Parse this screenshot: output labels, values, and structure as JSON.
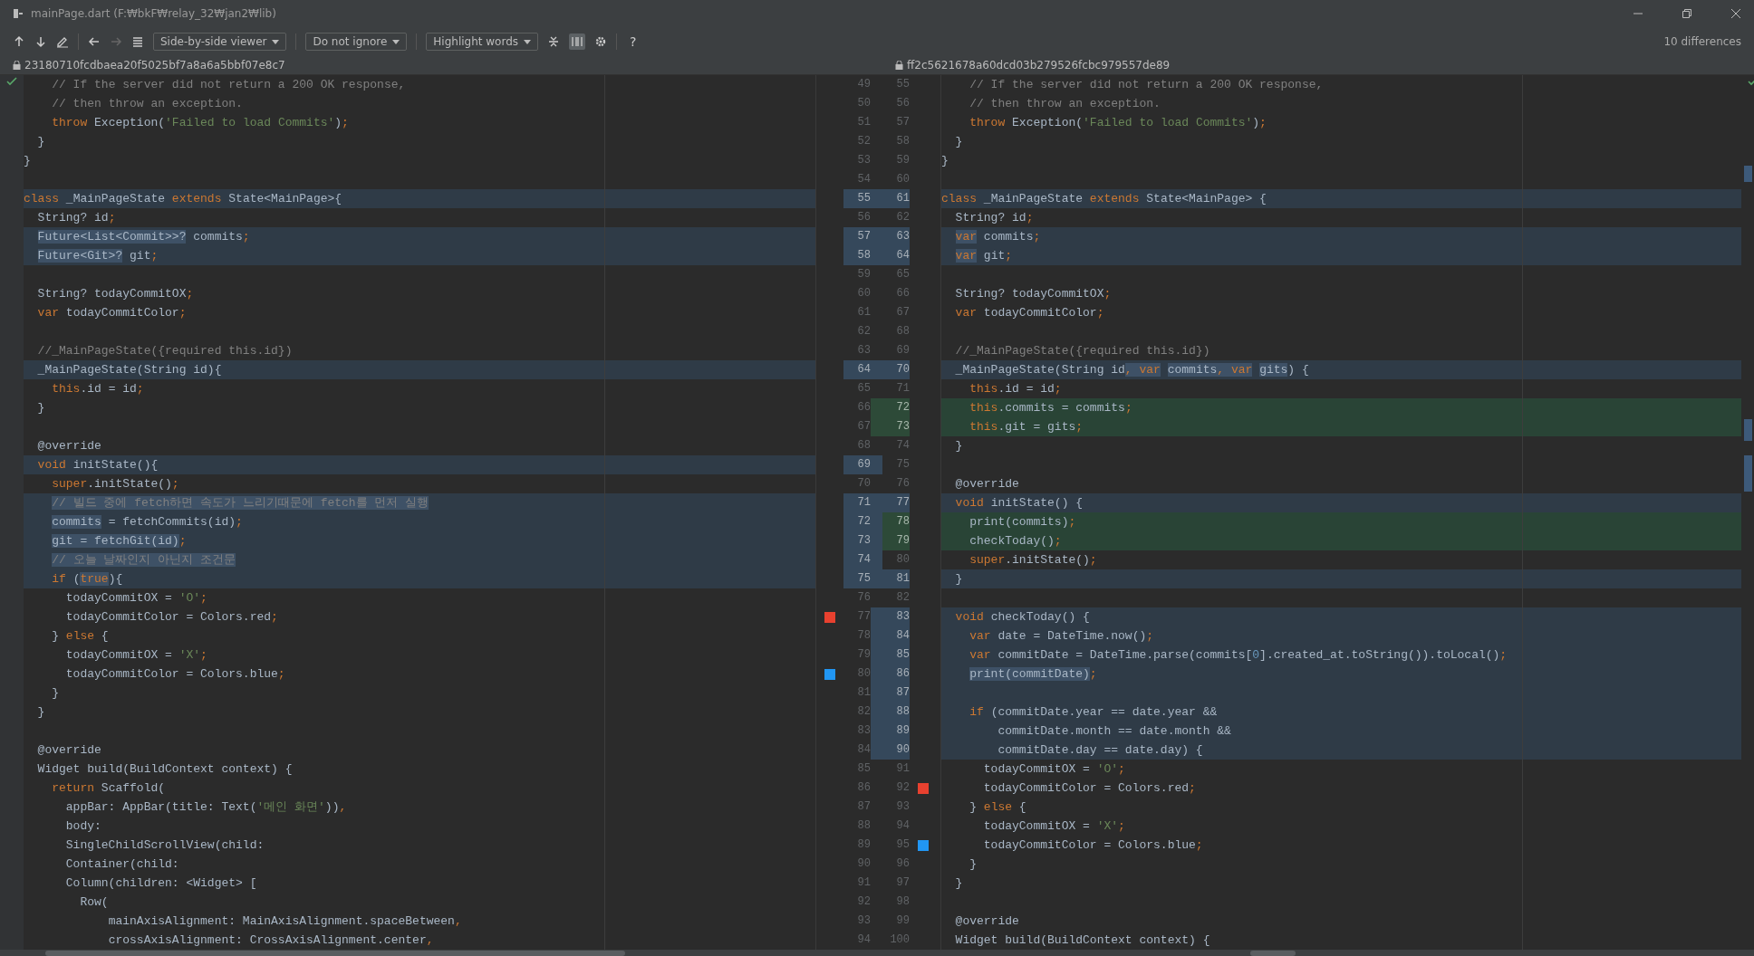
{
  "window": {
    "title": "mainPage.dart (F:₩bkF₩relay_32₩jan2₩lib)"
  },
  "toolbar": {
    "next_file": {
      "disabled": true
    },
    "viewer": "Side-by-side viewer",
    "ignore": "Do not ignore",
    "highlight": "Highlight words",
    "layout_toggle": {
      "selected": true
    },
    "help": "?",
    "differences": "10 differences"
  },
  "left": {
    "revision": "23180710fcdbaea20f5025bf7a8a6a5bbf07e8c7",
    "lines": [
      {
        "n": "49",
        "kind": "plain",
        "tokens": [
          {
            "t": "    // If the server did not return a 200 OK response,",
            "kind": "comment"
          }
        ]
      },
      {
        "n": "50",
        "kind": "plain",
        "tokens": [
          {
            "t": "    // then throw an exception.",
            "kind": "comment"
          }
        ]
      },
      {
        "n": "51",
        "kind": "plain",
        "tokens": [
          {
            "t": "    throw",
            "kind": "keyword"
          },
          {
            "t": " Exception("
          },
          {
            "t": "'Failed to load Commits'",
            "kind": "string"
          },
          {
            "t": ");"
          }
        ]
      },
      {
        "n": "52",
        "kind": "plain",
        "tokens": [
          {
            "t": "  }"
          }
        ]
      },
      {
        "n": "53",
        "kind": "plain",
        "tokens": [
          {
            "t": "}"
          }
        ]
      },
      {
        "n": "54",
        "kind": "plain"
      },
      {
        "n": "55",
        "kind": "changed",
        "tokens": [
          {
            "t": "class",
            "kind": "keyword"
          },
          {
            "t": " _MainPageState "
          },
          {
            "t": "extends",
            "kind": "keyword"
          },
          {
            "t": " State<MainPage>{"
          }
        ]
      },
      {
        "n": "56",
        "kind": "plain",
        "tokens": [
          {
            "t": "  String? id;"
          }
        ]
      },
      {
        "n": "57",
        "kind": "changed",
        "tokens": [
          {
            "t": "  Future<List<Commit>>?",
            "hl": true
          },
          {
            "t": " commits;"
          }
        ]
      },
      {
        "n": "58",
        "kind": "changed",
        "tokens": [
          {
            "t": "  Future<Git>?",
            "hl": true
          },
          {
            "t": " git;"
          }
        ]
      },
      {
        "n": "59",
        "kind": "plain"
      },
      {
        "n": "60",
        "kind": "plain",
        "tokens": [
          {
            "t": "  String? todayCommitOX;"
          }
        ]
      },
      {
        "n": "61",
        "kind": "plain",
        "tokens": [
          {
            "t": "  var",
            "kind": "keyword"
          },
          {
            "t": " todayCommitColor;"
          }
        ]
      },
      {
        "n": "62",
        "kind": "plain"
      },
      {
        "n": "63",
        "kind": "plain",
        "tokens": [
          {
            "t": "  //_MainPageState({required this.id})",
            "kind": "comment"
          }
        ]
      },
      {
        "n": "64",
        "kind": "changed",
        "tokens": [
          {
            "t": "  _MainPageState(String id){"
          }
        ]
      },
      {
        "n": "65",
        "kind": "plain",
        "tokens": [
          {
            "t": "    this",
            "kind": "keyword"
          },
          {
            "t": ".id = id;"
          }
        ]
      },
      {
        "n": "66",
        "kind": "plain",
        "tokens": [
          {
            "t": "  }"
          }
        ]
      },
      {
        "n": "67",
        "kind": "plain"
      },
      {
        "n": "68",
        "kind": "plain",
        "tokens": [
          {
            "t": "  @override"
          }
        ]
      },
      {
        "n": "69",
        "kind": "changed",
        "tokens": [
          {
            "t": "  void",
            "kind": "keyword"
          },
          {
            "t": " initState(){"
          }
        ]
      },
      {
        "n": "70",
        "kind": "plain",
        "tokens": [
          {
            "t": "    super",
            "kind": "keyword"
          },
          {
            "t": ".initState();"
          }
        ]
      },
      {
        "n": "71",
        "kind": "changed",
        "tokens": [
          {
            "t": "    // 빌드 중에 fetch하면 속도가 느리기때문에 fetch를 먼저 실행",
            "kind": "comment",
            "hl": true
          }
        ]
      },
      {
        "n": "72",
        "kind": "changed",
        "tokens": [
          {
            "t": "    commits",
            "hl": true
          },
          {
            "t": " = fetchCommits(id);"
          }
        ]
      },
      {
        "n": "73",
        "kind": "changed",
        "tokens": [
          {
            "t": "    git = fetchGit(id)",
            "hl": true
          },
          {
            "t": ";"
          }
        ]
      },
      {
        "n": "74",
        "kind": "changed",
        "tokens": [
          {
            "t": "    // 오늘 날짜인지 아닌지 조건문",
            "kind": "comment",
            "hl": true
          }
        ]
      },
      {
        "n": "75",
        "kind": "changed",
        "tokens": [
          {
            "t": "    if",
            "kind": "keyword"
          },
          {
            "t": " ("
          },
          {
            "t": "true",
            "kind": "keyword",
            "hl": true
          },
          {
            "t": "){"
          }
        ]
      },
      {
        "n": "76",
        "kind": "plain",
        "tokens": [
          {
            "t": "      todayCommitOX = "
          },
          {
            "t": "'O'",
            "kind": "string"
          },
          {
            "t": ";"
          }
        ]
      },
      {
        "n": "77",
        "kind": "plain",
        "color": "#e8412f",
        "tokens": [
          {
            "t": "      todayCommitColor = Colors.red;"
          }
        ]
      },
      {
        "n": "78",
        "kind": "plain",
        "tokens": [
          {
            "t": "    } "
          },
          {
            "t": "else",
            "kind": "keyword"
          },
          {
            "t": " {"
          }
        ]
      },
      {
        "n": "79",
        "kind": "plain",
        "tokens": [
          {
            "t": "      todayCommitOX = "
          },
          {
            "t": "'X'",
            "kind": "string"
          },
          {
            "t": ";"
          }
        ]
      },
      {
        "n": "80",
        "kind": "plain",
        "color": "#2196f3",
        "tokens": [
          {
            "t": "      todayCommitColor = Colors.blue;"
          }
        ]
      },
      {
        "n": "81",
        "kind": "plain",
        "tokens": [
          {
            "t": "    }"
          }
        ]
      },
      {
        "n": "82",
        "kind": "plain",
        "tokens": [
          {
            "t": "  }"
          }
        ]
      },
      {
        "n": "83",
        "kind": "plain"
      },
      {
        "n": "84",
        "kind": "plain",
        "tokens": [
          {
            "t": "  @override"
          }
        ]
      },
      {
        "n": "85",
        "kind": "plain",
        "tokens": [
          {
            "t": "  Widget build(BuildContext context) {"
          }
        ]
      },
      {
        "n": "86",
        "kind": "plain",
        "tokens": [
          {
            "t": "    return",
            "kind": "keyword"
          },
          {
            "t": " Scaffold("
          }
        ]
      },
      {
        "n": "87",
        "kind": "plain",
        "tokens": [
          {
            "t": "      appBar: AppBar(title: Text("
          },
          {
            "t": "'메인 화면'",
            "kind": "string"
          },
          {
            "t": ")),"
          }
        ]
      },
      {
        "n": "88",
        "kind": "plain",
        "tokens": [
          {
            "t": "      body:"
          }
        ]
      },
      {
        "n": "89",
        "kind": "plain",
        "tokens": [
          {
            "t": "      SingleChildScrollView(child:"
          }
        ]
      },
      {
        "n": "90",
        "kind": "plain",
        "tokens": [
          {
            "t": "      Container(child:"
          }
        ]
      },
      {
        "n": "91",
        "kind": "plain",
        "tokens": [
          {
            "t": "      Column(children: <Widget> ["
          }
        ]
      },
      {
        "n": "92",
        "kind": "plain",
        "tokens": [
          {
            "t": "        Row("
          }
        ]
      },
      {
        "n": "93",
        "kind": "plain",
        "tokens": [
          {
            "t": "            mainAxisAlignment: MainAxisAlignment.spaceBetween,"
          }
        ]
      },
      {
        "n": "94",
        "kind": "plain",
        "tokens": [
          {
            "t": "            crossAxisAlignment: CrossAxisAlignment.center,"
          }
        ]
      }
    ]
  },
  "right": {
    "revision": "ff2c5621678a60dcd03b279526fcbc979557de89",
    "lines": [
      {
        "n": "55",
        "kind": "plain",
        "tokens": [
          {
            "t": "    // If the server did not return a 200 OK response,",
            "kind": "comment"
          }
        ]
      },
      {
        "n": "56",
        "kind": "plain",
        "tokens": [
          {
            "t": "    // then throw an exception.",
            "kind": "comment"
          }
        ]
      },
      {
        "n": "57",
        "kind": "plain",
        "tokens": [
          {
            "t": "    throw",
            "kind": "keyword"
          },
          {
            "t": " Exception("
          },
          {
            "t": "'Failed to load Commits'",
            "kind": "string"
          },
          {
            "t": ");"
          }
        ]
      },
      {
        "n": "58",
        "kind": "plain",
        "tokens": [
          {
            "t": "  }"
          }
        ]
      },
      {
        "n": "59",
        "kind": "plain",
        "tokens": [
          {
            "t": "}"
          }
        ]
      },
      {
        "n": "60",
        "kind": "plain"
      },
      {
        "n": "61",
        "kind": "changed",
        "tokens": [
          {
            "t": "class",
            "kind": "keyword"
          },
          {
            "t": " _MainPageState "
          },
          {
            "t": "extends",
            "kind": "keyword"
          },
          {
            "t": " State<MainPage> {"
          }
        ]
      },
      {
        "n": "62",
        "kind": "plain",
        "tokens": [
          {
            "t": "  String? id;"
          }
        ]
      },
      {
        "n": "63",
        "kind": "changed",
        "tokens": [
          {
            "t": "  var",
            "kind": "keyword",
            "hl": true
          },
          {
            "t": " commits;"
          }
        ]
      },
      {
        "n": "64",
        "kind": "changed",
        "tokens": [
          {
            "t": "  var",
            "kind": "keyword",
            "hl": true
          },
          {
            "t": " git;"
          }
        ]
      },
      {
        "n": "65",
        "kind": "plain"
      },
      {
        "n": "66",
        "kind": "plain",
        "tokens": [
          {
            "t": "  String? todayCommitOX;"
          }
        ]
      },
      {
        "n": "67",
        "kind": "plain",
        "tokens": [
          {
            "t": "  var",
            "kind": "keyword"
          },
          {
            "t": " todayCommitColor;"
          }
        ]
      },
      {
        "n": "68",
        "kind": "plain"
      },
      {
        "n": "69",
        "kind": "plain",
        "tokens": [
          {
            "t": "  //_MainPageState({required this.id})",
            "kind": "comment"
          }
        ]
      },
      {
        "n": "70",
        "kind": "changed",
        "tokens": [
          {
            "t": "  _MainPageState(String id"
          },
          {
            "t": ", ",
            "hl": true
          },
          {
            "t": "var",
            "kind": "keyword",
            "hl": true
          },
          {
            "t": " commits, ",
            "hl": true
          },
          {
            "t": "var",
            "kind": "keyword",
            "hl": true
          },
          {
            "t": " gits",
            "hl": true
          },
          {
            "t": ") {"
          }
        ]
      },
      {
        "n": "71",
        "kind": "plain",
        "tokens": [
          {
            "t": "    this",
            "kind": "keyword"
          },
          {
            "t": ".id = id;"
          }
        ]
      },
      {
        "n": "72",
        "kind": "inserted",
        "tokens": [
          {
            "t": "    this",
            "kind": "keyword"
          },
          {
            "t": ".commits = commits;"
          }
        ]
      },
      {
        "n": "73",
        "kind": "inserted",
        "tokens": [
          {
            "t": "    this",
            "kind": "keyword"
          },
          {
            "t": ".git = gits;"
          }
        ]
      },
      {
        "n": "74",
        "kind": "plain",
        "tokens": [
          {
            "t": "  }"
          }
        ]
      },
      {
        "n": "75",
        "kind": "plain"
      },
      {
        "n": "76",
        "kind": "plain",
        "tokens": [
          {
            "t": "  @override"
          }
        ]
      },
      {
        "n": "77",
        "kind": "changed",
        "tokens": [
          {
            "t": "  void",
            "kind": "keyword"
          },
          {
            "t": " initState() {"
          }
        ]
      },
      {
        "n": "78",
        "kind": "inserted",
        "tokens": [
          {
            "t": "    print(commits);"
          }
        ]
      },
      {
        "n": "79",
        "kind": "inserted",
        "tokens": [
          {
            "t": "    checkToday();"
          }
        ]
      },
      {
        "n": "80",
        "kind": "plain",
        "tokens": [
          {
            "t": "    super",
            "kind": "keyword"
          },
          {
            "t": ".initState();"
          }
        ]
      },
      {
        "n": "81",
        "kind": "changed",
        "tokens": [
          {
            "t": "  }"
          }
        ]
      },
      {
        "n": "82",
        "kind": "plain"
      },
      {
        "n": "83",
        "kind": "changed",
        "tokens": [
          {
            "t": "  void",
            "kind": "keyword"
          },
          {
            "t": " checkToday() {"
          }
        ]
      },
      {
        "n": "84",
        "kind": "changed",
        "tokens": [
          {
            "t": "    var",
            "kind": "keyword"
          },
          {
            "t": " date = DateTime.now();"
          }
        ]
      },
      {
        "n": "85",
        "kind": "changed",
        "tokens": [
          {
            "t": "    var",
            "kind": "keyword"
          },
          {
            "t": " commitDate = DateTime.parse(commits["
          },
          {
            "t": "0",
            "kind": "number"
          },
          {
            "t": "].created_at.toString()).toLocal();"
          }
        ]
      },
      {
        "n": "86",
        "kind": "changed",
        "tokens": [
          {
            "t": "    print(commitDate)",
            "hl": true
          },
          {
            "t": ";"
          }
        ]
      },
      {
        "n": "87",
        "kind": "changed"
      },
      {
        "n": "88",
        "kind": "changed",
        "tokens": [
          {
            "t": "    if",
            "kind": "keyword"
          },
          {
            "t": " (commitDate.year == date.year &&"
          }
        ]
      },
      {
        "n": "89",
        "kind": "changed",
        "tokens": [
          {
            "t": "        commitDate.month == date.month &&"
          }
        ]
      },
      {
        "n": "90",
        "kind": "changed",
        "tokens": [
          {
            "t": "        commitDate.day == date.day) {"
          }
        ]
      },
      {
        "n": "91",
        "kind": "plain",
        "tokens": [
          {
            "t": "      todayCommitOX = "
          },
          {
            "t": "'O'",
            "kind": "string"
          },
          {
            "t": ";"
          }
        ]
      },
      {
        "n": "92",
        "kind": "plain",
        "color": "#e8412f",
        "tokens": [
          {
            "t": "      todayCommitColor = Colors.red;"
          }
        ]
      },
      {
        "n": "93",
        "kind": "plain",
        "tokens": [
          {
            "t": "    } "
          },
          {
            "t": "else",
            "kind": "keyword"
          },
          {
            "t": " {"
          }
        ]
      },
      {
        "n": "94",
        "kind": "plain",
        "tokens": [
          {
            "t": "      todayCommitOX = "
          },
          {
            "t": "'X'",
            "kind": "string"
          },
          {
            "t": ";"
          }
        ]
      },
      {
        "n": "95",
        "kind": "plain",
        "color": "#2196f3",
        "tokens": [
          {
            "t": "      todayCommitColor = Colors.blue;"
          }
        ]
      },
      {
        "n": "96",
        "kind": "plain",
        "tokens": [
          {
            "t": "    }"
          }
        ]
      },
      {
        "n": "97",
        "kind": "plain",
        "tokens": [
          {
            "t": "  }"
          }
        ]
      },
      {
        "n": "98",
        "kind": "plain"
      },
      {
        "n": "99",
        "kind": "plain",
        "tokens": [
          {
            "t": "  @override"
          }
        ]
      },
      {
        "n": "100",
        "kind": "plain",
        "tokens": [
          {
            "t": "  Widget build(BuildContext context) {"
          }
        ]
      }
    ]
  }
}
